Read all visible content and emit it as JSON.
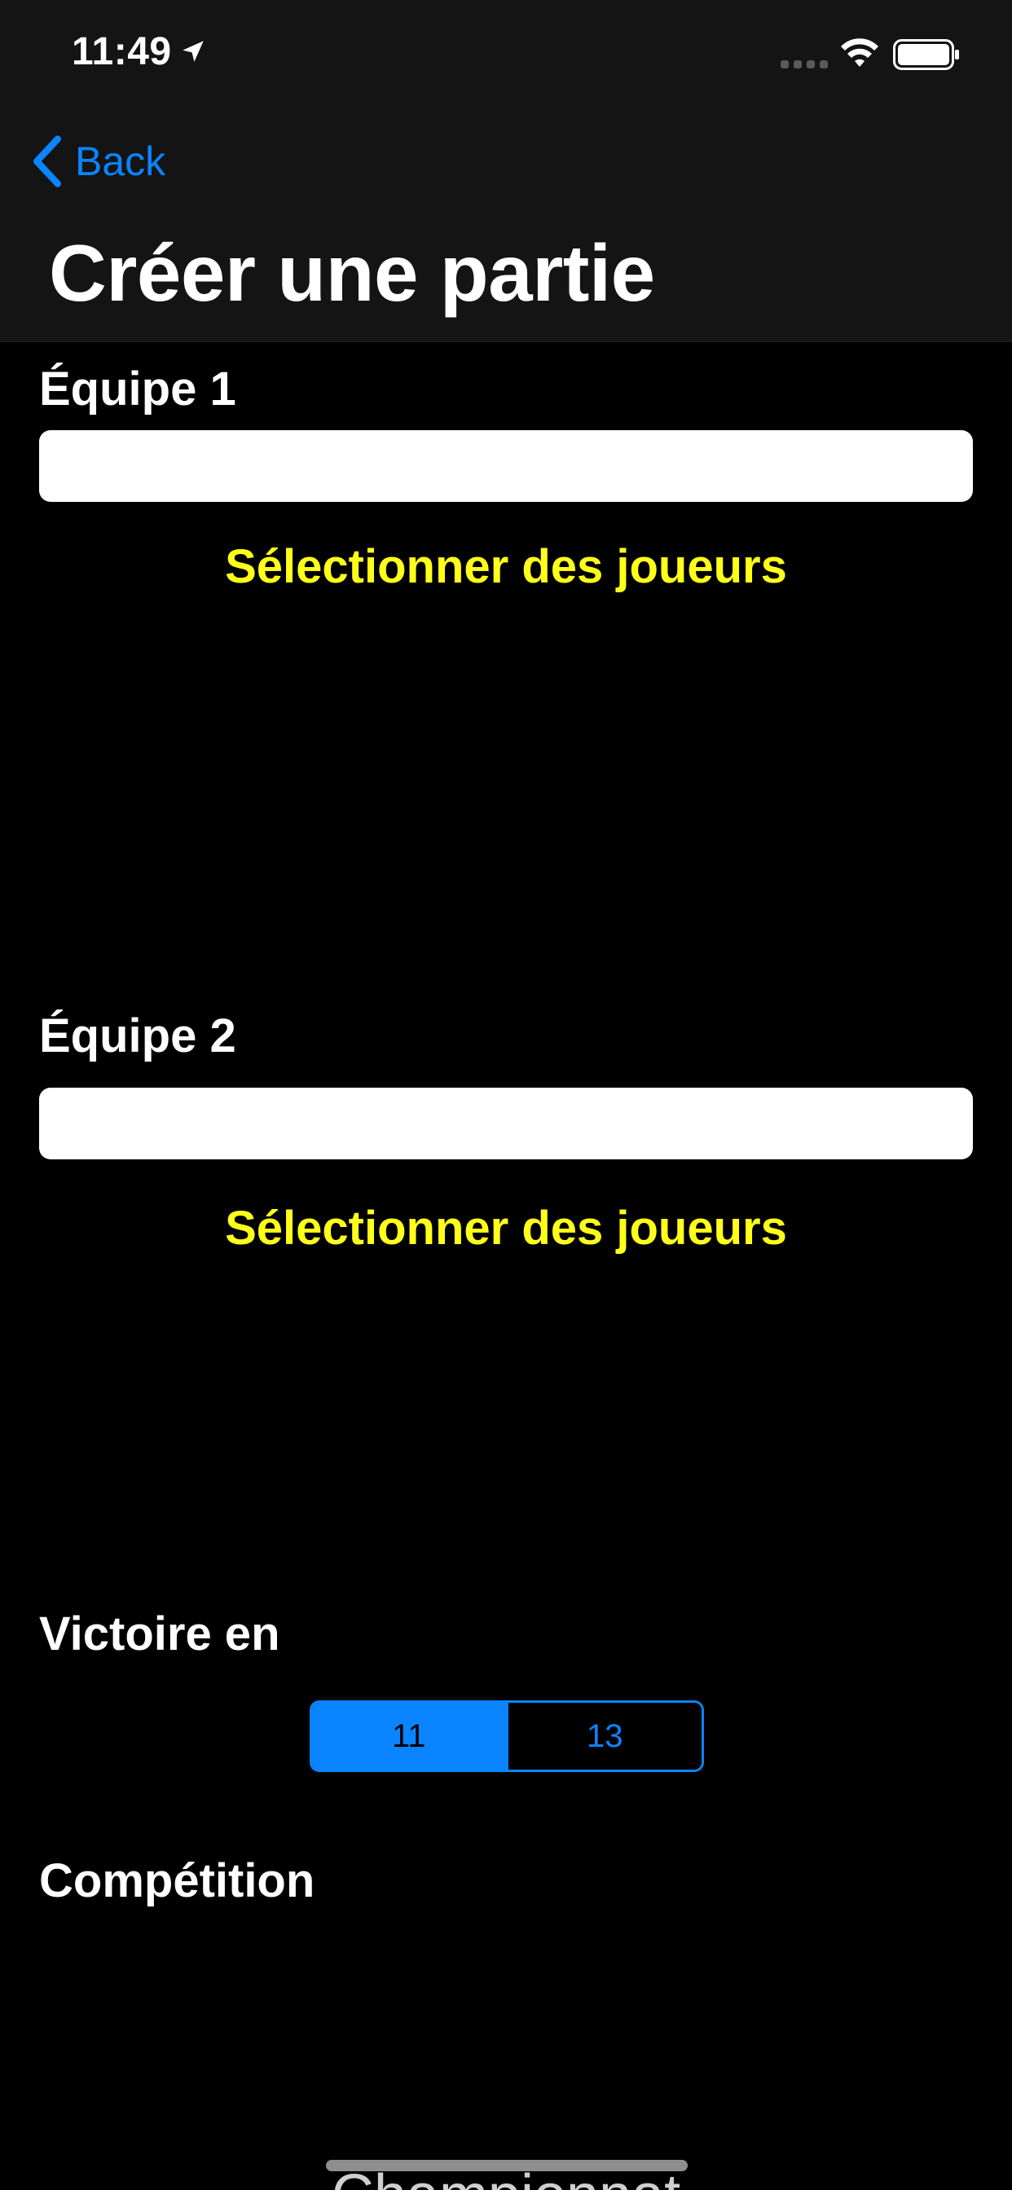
{
  "status_bar": {
    "time": "11:49"
  },
  "nav": {
    "back_label": "Back",
    "title": "Créer une partie"
  },
  "team1": {
    "label": "Équipe 1",
    "value": "",
    "select_players": "Sélectionner des joueurs"
  },
  "team2": {
    "label": "Équipe 2",
    "value": "",
    "select_players": "Sélectionner des joueurs"
  },
  "victory": {
    "label": "Victoire en",
    "options": [
      "11",
      "13"
    ],
    "selected": "11"
  },
  "competition": {
    "label": "Compétition",
    "partial_value": "Championnat"
  },
  "colors": {
    "accent": "#0a84ff",
    "highlight": "#ffff1a",
    "background": "#000000",
    "nav_background": "#141414"
  },
  "icons": [
    "location-arrow-icon",
    "signal-icon",
    "wifi-icon",
    "battery-icon",
    "chevron-left-icon"
  ]
}
